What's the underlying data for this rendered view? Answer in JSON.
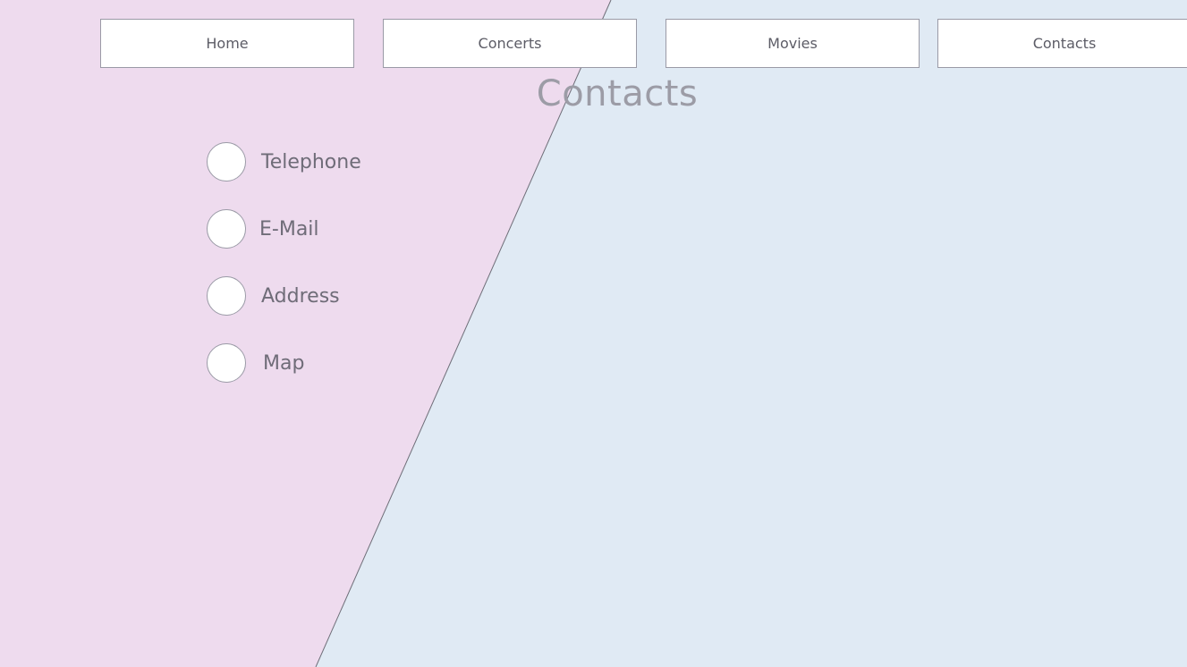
{
  "nav": {
    "items": [
      {
        "label": "Home"
      },
      {
        "label": "Concerts"
      },
      {
        "label": "Movies"
      },
      {
        "label": "Contacts"
      }
    ]
  },
  "main": {
    "title": "Contacts",
    "options": [
      {
        "label": "Telephone"
      },
      {
        "label": "E-Mail"
      },
      {
        "label": "Address"
      },
      {
        "label": "Map"
      }
    ]
  },
  "colors": {
    "left_panel": "#eedbee",
    "right_panel": "#e0eaf4",
    "title_text": "#9c9ca6",
    "option_text": "#6f6c78",
    "border": "#9a9aa6"
  }
}
